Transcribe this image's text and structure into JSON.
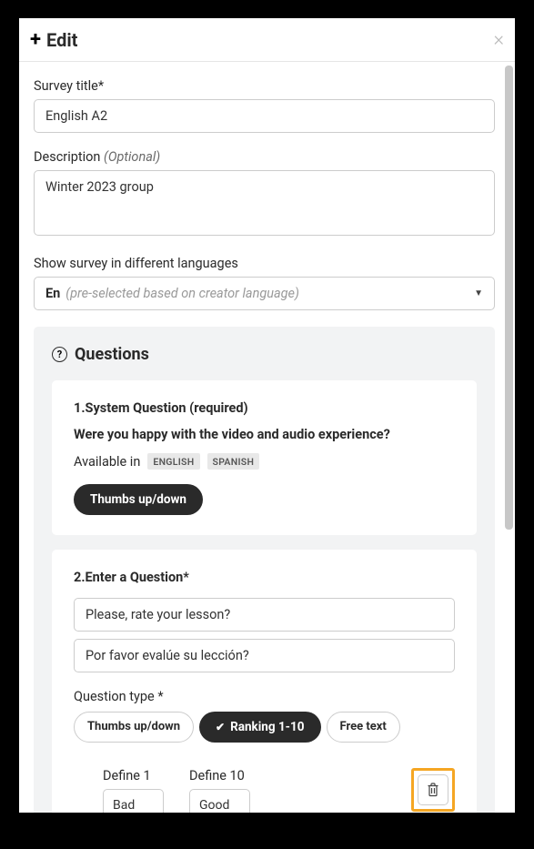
{
  "modal": {
    "title": "Edit"
  },
  "survey": {
    "title_label": "Survey title*",
    "title_value": "English A2",
    "desc_label": "Description ",
    "desc_optional": "(Optional)",
    "desc_value": "Winter 2023 group",
    "lang_label": "Show survey in different languages",
    "lang_selected": "En",
    "lang_hint": "(pre-selected based on creator language)"
  },
  "questions": {
    "heading": "Questions",
    "q1": {
      "line1": "1.System Question (required)",
      "line2": "Were you happy with the video and audio experience?",
      "avail_label": "Available in",
      "langs": [
        "ENGLISH",
        "SPANISH"
      ],
      "answer_type": "Thumbs up/down"
    },
    "q2": {
      "header": "2.Enter a Question*",
      "input1": "Please, rate your lesson?",
      "input2": "Por favor evalúe su lección?",
      "qtype_label": "Question type *",
      "types": {
        "thumbs": "Thumbs up/down",
        "ranking": "Ranking 1-10",
        "freetext": "Free text"
      },
      "define1_label": "Define 1",
      "define1_value": "Bad",
      "define10_label": "Define 10",
      "define10_value": "Good"
    }
  }
}
